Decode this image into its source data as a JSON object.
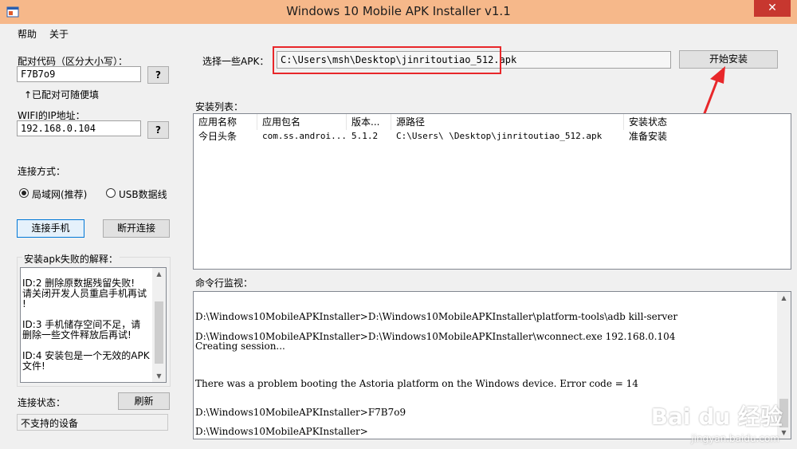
{
  "window": {
    "title": "Windows 10 Mobile APK Installer v1.1",
    "close_glyph": "✕"
  },
  "menu": [
    {
      "label": "帮助"
    },
    {
      "label": "关于"
    }
  ],
  "left": {
    "pair_code_label": "配对代码（区分大小写）：",
    "pair_code_value": "F7B7o9",
    "help_btn": "?",
    "pair_hint": "↑已配对可随便填",
    "wifi_label": "WIFI的IP地址：",
    "wifi_value": "192.168.0.104",
    "wifi_help_btn": "?",
    "conn_method_label": "连接方式：",
    "radio_lan": "局域网(推荐)",
    "radio_usb": "USB数据线",
    "connect_btn": "连接手机",
    "disconnect_btn": "断开连接",
    "explain_title": "安装apk失败的解释：",
    "explain_lines": [
      "ID:2 删除原数据残留失败!",
      "请关闭开发人员重启手机再试",
      "!",
      "",
      "ID:3 手机储存空间不足，请",
      "删除一些文件释放后再试!",
      "",
      "ID:4 安装包是一个无效的APK",
      "文件!"
    ],
    "status_label": "连接状态：",
    "refresh_btn": "刷新",
    "status_value": "不支持的设备"
  },
  "right": {
    "select_apk_label": "选择一些APK：",
    "apk_path": "C:\\Users\\msh\\Desktop\\jinritoutiao_512.apk",
    "install_btn": "开始安装",
    "install_list_label": "安装列表：",
    "columns": [
      "应用名称",
      "应用包名",
      "版本...",
      "源路径",
      "安装状态"
    ],
    "rows": [
      [
        "今日头条",
        "com.ss.androi...",
        "5.1.2",
        "C:\\Users\\        \\Desktop\\jinritoutiao_512.apk",
        "准备安装"
      ]
    ],
    "console_label": "命令行监视：",
    "console_lines": [
      "D:\\Windows10MobileAPKInstaller>D:\\Windows10MobileAPKInstaller\\platform-tools\\adb kill-server",
      "D:\\Windows10MobileAPKInstaller>D:\\Windows10MobileAPKInstaller\\wconnect.exe 192.168.0.104",
      "Creating session...",
      "There was a problem booting the Astoria platform on the Windows device. Error code = 14",
      "D:\\Windows10MobileAPKInstaller>F7B7o9",
      "D:\\Windows10MobileAPKInstaller>"
    ]
  },
  "watermark": {
    "brand": "Bai du 经验",
    "site": "jingyan.baidu.com"
  },
  "colors": {
    "titlebar": "#f6b88a",
    "close": "#c7372f",
    "highlight": "#e8272a"
  }
}
